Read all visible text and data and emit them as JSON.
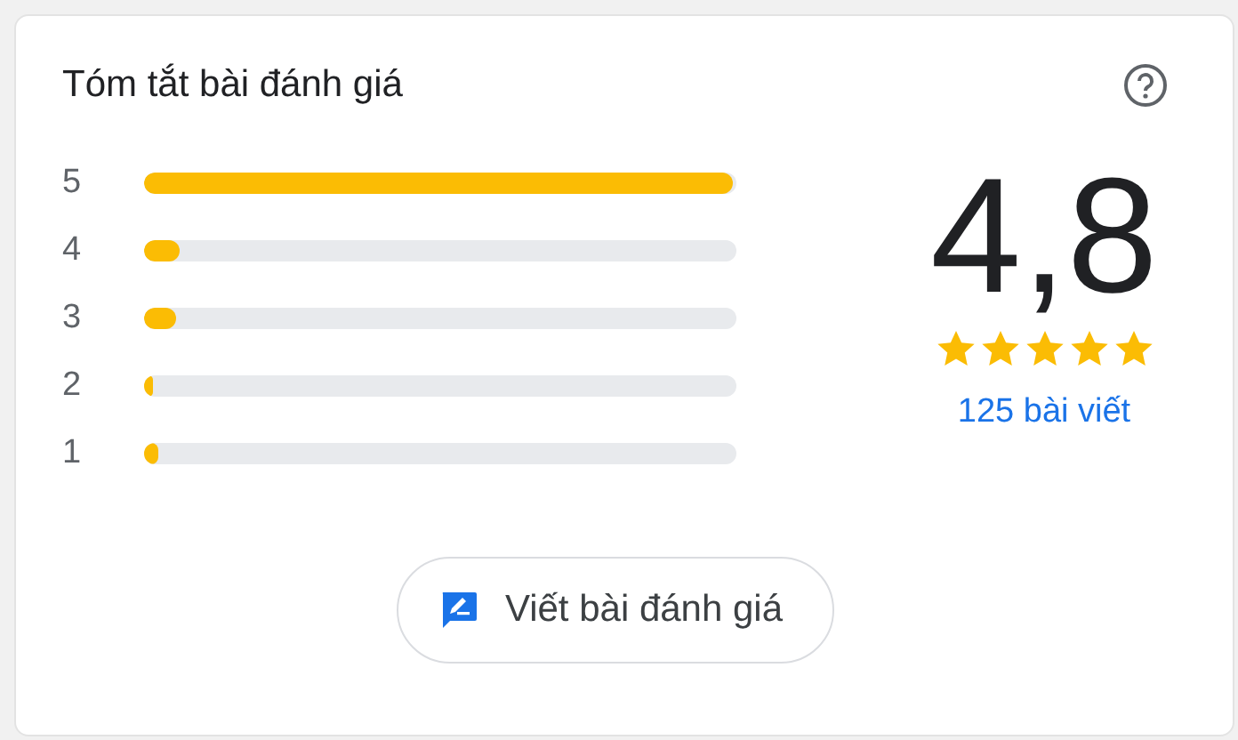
{
  "title": "Tóm tắt bài đánh giá",
  "distribution": [
    {
      "label": "5",
      "level": 1.0
    },
    {
      "label": "4",
      "level": 0.06
    },
    {
      "label": "3",
      "level": 0.055
    },
    {
      "label": "2",
      "level": 0.01
    },
    {
      "label": "1",
      "level": 0.025
    }
  ],
  "rating": {
    "value": "4,8",
    "stars": 5,
    "count": "125 bài viết"
  },
  "write_button": {
    "label": "Viết bài đánh giá"
  }
}
